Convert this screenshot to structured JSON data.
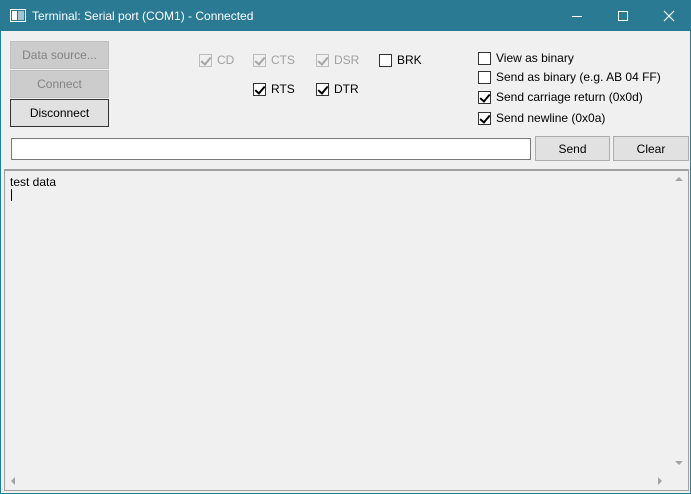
{
  "window": {
    "title": "Terminal: Serial port (COM1) - Connected"
  },
  "buttons": {
    "data_source": "Data source...",
    "connect": "Connect",
    "disconnect": "Disconnect",
    "send": "Send",
    "clear": "Clear"
  },
  "signals": {
    "cd": {
      "label": "CD",
      "checked": true,
      "enabled": false
    },
    "cts": {
      "label": "CTS",
      "checked": true,
      "enabled": false
    },
    "dsr": {
      "label": "DSR",
      "checked": true,
      "enabled": false
    },
    "brk": {
      "label": "BRK",
      "checked": false,
      "enabled": true
    },
    "rts": {
      "label": "RTS",
      "checked": true,
      "enabled": true
    },
    "dtr": {
      "label": "DTR",
      "checked": true,
      "enabled": true
    }
  },
  "options": {
    "view_binary": {
      "label": "View as binary",
      "checked": false
    },
    "send_binary": {
      "label": "Send as binary (e.g. AB 04 FF)",
      "checked": false
    },
    "send_cr": {
      "label": "Send carriage return (0x0d)",
      "checked": true
    },
    "send_lf": {
      "label": "Send newline (0x0a)",
      "checked": true
    }
  },
  "send_input": {
    "value": ""
  },
  "output": {
    "text": "test data"
  },
  "colors": {
    "titlebar": "#2b7a94"
  }
}
